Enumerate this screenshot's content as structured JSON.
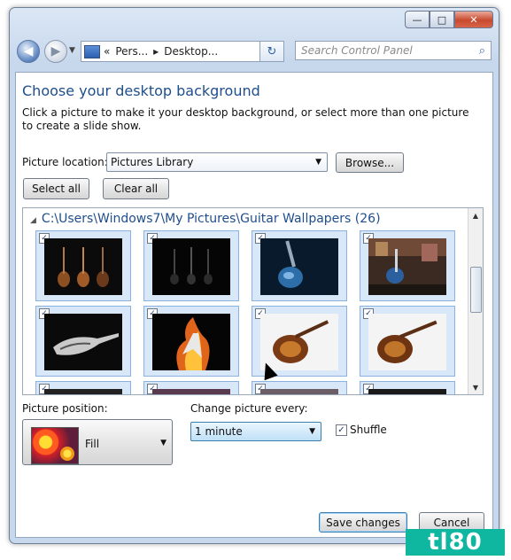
{
  "window": {
    "title_buttons": {
      "minimize": "—",
      "maximize": "□",
      "close": "✕"
    }
  },
  "address": {
    "sep": "«",
    "crumbs": [
      "Pers...",
      "Desktop..."
    ],
    "search_placeholder": "Search Control Panel"
  },
  "page": {
    "title": "Choose your desktop background",
    "description": "Click a picture to make it your desktop background, or select more than one picture to create a slide show.",
    "location_label": "Picture location:",
    "location_value": "Pictures Library",
    "browse": "Browse...",
    "select_all": "Select all",
    "clear_all": "Clear all",
    "group_title": "C:\\Users\\Windows7\\My Pictures\\Guitar Wallpapers (26)",
    "position_label": "Picture position:",
    "position_value": "Fill",
    "interval_label": "Change picture every:",
    "interval_value": "1 minute",
    "shuffle": "Shuffle",
    "save": "Save changes",
    "cancel": "Cancel"
  },
  "tiles": [
    {
      "checked": true
    },
    {
      "checked": true
    },
    {
      "checked": true
    },
    {
      "checked": true
    },
    {
      "checked": true
    },
    {
      "checked": true
    },
    {
      "checked": true
    },
    {
      "checked": true
    },
    {
      "checked": true
    },
    {
      "checked": true
    },
    {
      "checked": true
    },
    {
      "checked": true
    }
  ],
  "shuffle_checked": true,
  "watermark": "tl80",
  "colors": {
    "accent": "#1e4e8c",
    "tile_bg": "#d9e8f8",
    "tile_border": "#8bb1df"
  }
}
